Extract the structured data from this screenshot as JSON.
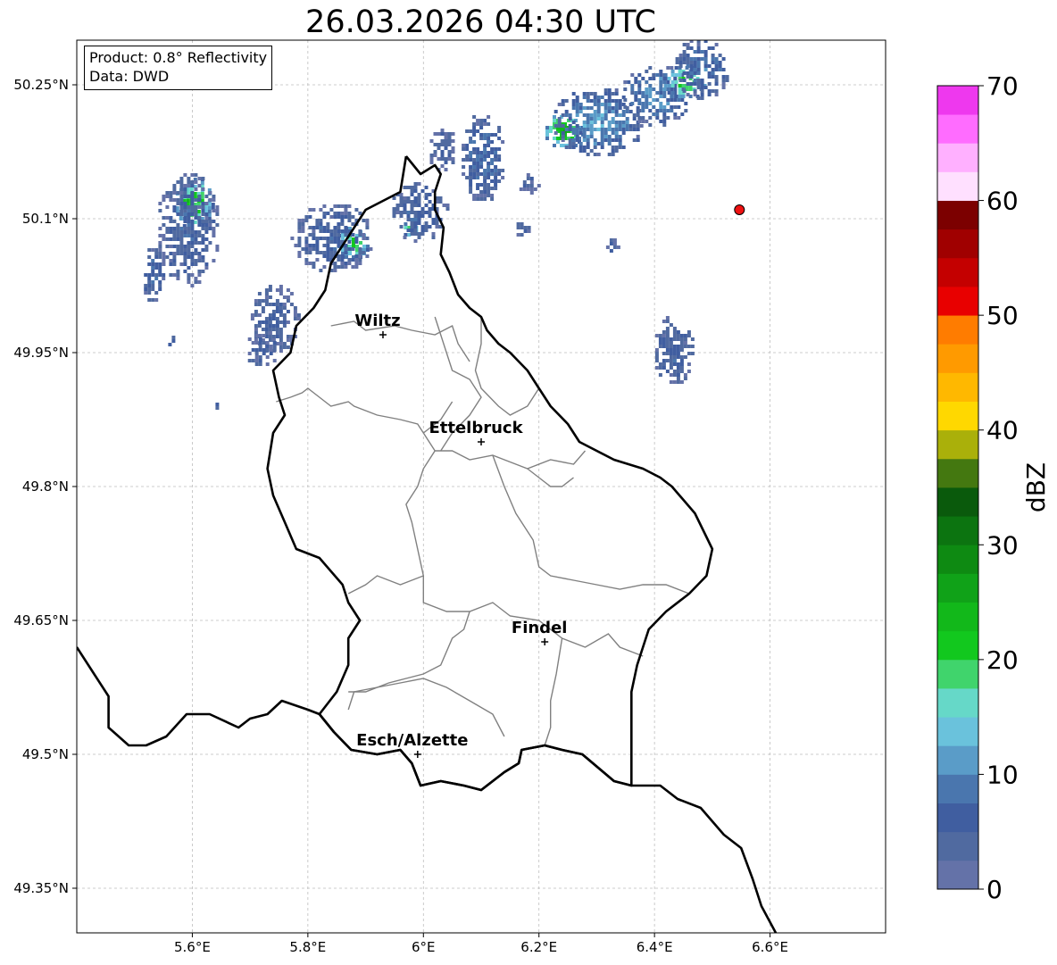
{
  "title": "26.03.2026 04:30 UTC",
  "info": {
    "product": "Product: 0.8° Reflectivity",
    "source": "Data: DWD"
  },
  "axes": {
    "x_ticks": [
      {
        "value": 5.6,
        "label": "5.6°E"
      },
      {
        "value": 5.8,
        "label": "5.8°E"
      },
      {
        "value": 6.0,
        "label": "6°E"
      },
      {
        "value": 6.2,
        "label": "6.2°E"
      },
      {
        "value": 6.4,
        "label": "6.4°E"
      },
      {
        "value": 6.6,
        "label": "6.6°E"
      }
    ],
    "y_ticks": [
      {
        "value": 50.25,
        "label": "50.25°N"
      },
      {
        "value": 50.1,
        "label": "50.1°N"
      },
      {
        "value": 49.95,
        "label": "49.95°N"
      },
      {
        "value": 49.8,
        "label": "49.8°N"
      },
      {
        "value": 49.65,
        "label": "49.65°N"
      },
      {
        "value": 49.5,
        "label": "49.5°N"
      },
      {
        "value": 49.35,
        "label": "49.35°N"
      }
    ],
    "lon_range": [
      5.4,
      6.8
    ],
    "lat_range": [
      49.3,
      50.3
    ],
    "grid": true
  },
  "cities": [
    {
      "name": "Wiltz",
      "lon": 5.93,
      "lat": 49.97
    },
    {
      "name": "Ettelbruck",
      "lon": 6.1,
      "lat": 49.85
    },
    {
      "name": "Findel",
      "lon": 6.21,
      "lat": 49.626
    },
    {
      "name": "Esch/Alzette",
      "lon": 5.99,
      "lat": 49.5
    }
  ],
  "radar_site": {
    "lon": 6.547,
    "lat": 50.11,
    "color": "#ee1111"
  },
  "colorbar": {
    "label": "dBZ",
    "min": 0,
    "max": 70,
    "step": 2.5,
    "tick_labels": [
      "0",
      "10",
      "20",
      "30",
      "40",
      "50",
      "60",
      "70"
    ],
    "colors": [
      "#6472a8",
      "#506aa0",
      "#405ea0",
      "#4a76ae",
      "#5a9cc8",
      "#6ac2dc",
      "#66d8c8",
      "#40d46c",
      "#12c81e",
      "#12b81a",
      "#10a218",
      "#0e8a12",
      "#0c7410",
      "#0a5a0c",
      "#447810",
      "#aab00a",
      "#ffd800",
      "#ffb800",
      "#ff9a00",
      "#ff7c00",
      "#e80000",
      "#c40000",
      "#a00000",
      "#7c0000",
      "#ffe0ff",
      "#ffb0ff",
      "#ff6cff",
      "#ee38ee"
    ]
  },
  "echoes": [
    {
      "lon": 5.6,
      "lat": 50.12,
      "rx": 0.035,
      "ry": 0.03,
      "dbz": 22
    },
    {
      "lon": 5.59,
      "lat": 50.09,
      "rx": 0.055,
      "ry": 0.065,
      "dbz": 6
    },
    {
      "lon": 5.53,
      "lat": 50.04,
      "rx": 0.02,
      "ry": 0.035,
      "dbz": 7
    },
    {
      "lon": 5.875,
      "lat": 50.075,
      "rx": 0.03,
      "ry": 0.02,
      "dbz": 20
    },
    {
      "lon": 5.84,
      "lat": 50.08,
      "rx": 0.07,
      "ry": 0.04,
      "dbz": 6
    },
    {
      "lon": 5.74,
      "lat": 49.99,
      "rx": 0.045,
      "ry": 0.04,
      "dbz": 5
    },
    {
      "lon": 5.72,
      "lat": 49.955,
      "rx": 0.03,
      "ry": 0.02,
      "dbz": 5
    },
    {
      "lon": 5.975,
      "lat": 50.09,
      "rx": 0.015,
      "ry": 0.01,
      "dbz": 18
    },
    {
      "lon": 5.99,
      "lat": 50.11,
      "rx": 0.05,
      "ry": 0.035,
      "dbz": 6
    },
    {
      "lon": 6.1,
      "lat": 50.17,
      "rx": 0.04,
      "ry": 0.05,
      "dbz": 8
    },
    {
      "lon": 6.03,
      "lat": 50.18,
      "rx": 0.025,
      "ry": 0.025,
      "dbz": 5
    },
    {
      "lon": 6.24,
      "lat": 50.2,
      "rx": 0.035,
      "ry": 0.02,
      "dbz": 24
    },
    {
      "lon": 6.3,
      "lat": 50.21,
      "rx": 0.08,
      "ry": 0.04,
      "dbz": 11
    },
    {
      "lon": 6.4,
      "lat": 50.24,
      "rx": 0.06,
      "ry": 0.035,
      "dbz": 10
    },
    {
      "lon": 6.45,
      "lat": 50.255,
      "rx": 0.04,
      "ry": 0.02,
      "dbz": 20
    },
    {
      "lon": 6.48,
      "lat": 50.27,
      "rx": 0.05,
      "ry": 0.035,
      "dbz": 8
    },
    {
      "lon": 6.43,
      "lat": 49.955,
      "rx": 0.035,
      "ry": 0.04,
      "dbz": 6
    },
    {
      "lon": 6.325,
      "lat": 50.07,
      "rx": 0.015,
      "ry": 0.012,
      "dbz": 4
    },
    {
      "lon": 6.17,
      "lat": 50.09,
      "rx": 0.015,
      "ry": 0.01,
      "dbz": 4
    },
    {
      "lon": 6.18,
      "lat": 50.14,
      "rx": 0.02,
      "ry": 0.015,
      "dbz": 4
    },
    {
      "lon": 5.56,
      "lat": 49.965,
      "rx": 0.008,
      "ry": 0.008,
      "dbz": 5
    },
    {
      "lon": 5.64,
      "lat": 49.89,
      "rx": 0.006,
      "ry": 0.008,
      "dbz": 5
    }
  ],
  "boundaries": {
    "country": [
      [
        [
          5.4,
          49.62
        ],
        [
          5.43,
          49.59
        ],
        [
          5.455,
          49.565
        ],
        [
          5.455,
          49.53
        ],
        [
          5.49,
          49.51
        ],
        [
          5.52,
          49.51
        ],
        [
          5.555,
          49.52
        ],
        [
          5.59,
          49.545
        ],
        [
          5.63,
          49.545
        ],
        [
          5.68,
          49.53
        ],
        [
          5.7,
          49.54
        ],
        [
          5.73,
          49.545
        ],
        [
          5.755,
          49.56
        ],
        [
          5.8,
          49.55
        ],
        [
          5.82,
          49.545
        ],
        [
          5.845,
          49.525
        ],
        [
          5.875,
          49.505
        ],
        [
          5.92,
          49.5
        ],
        [
          5.96,
          49.505
        ],
        [
          5.98,
          49.49
        ],
        [
          5.995,
          49.465
        ],
        [
          6.03,
          49.47
        ],
        [
          6.07,
          49.465
        ],
        [
          6.1,
          49.46
        ],
        [
          6.14,
          49.48
        ],
        [
          6.165,
          49.49
        ],
        [
          6.17,
          49.505
        ],
        [
          6.21,
          49.51
        ],
        [
          6.24,
          49.505
        ],
        [
          6.275,
          49.5
        ],
        [
          6.33,
          49.47
        ],
        [
          6.36,
          49.465
        ],
        [
          6.41,
          49.465
        ],
        [
          6.44,
          49.45
        ],
        [
          6.48,
          49.44
        ],
        [
          6.52,
          49.41
        ],
        [
          6.55,
          49.395
        ],
        [
          6.57,
          49.36
        ],
        [
          6.585,
          49.33
        ],
        [
          6.61,
          49.3
        ]
      ]
    ],
    "lux": [
      [
        [
          5.97,
          50.17
        ],
        [
          5.995,
          50.15
        ],
        [
          6.02,
          50.16
        ],
        [
          6.03,
          50.15
        ],
        [
          6.02,
          50.13
        ],
        [
          6.02,
          50.11
        ],
        [
          6.035,
          50.09
        ],
        [
          6.03,
          50.06
        ],
        [
          6.045,
          50.04
        ],
        [
          6.06,
          50.015
        ],
        [
          6.08,
          50.0
        ],
        [
          6.1,
          49.99
        ],
        [
          6.11,
          49.975
        ],
        [
          6.13,
          49.96
        ],
        [
          6.15,
          49.95
        ],
        [
          6.18,
          49.93
        ],
        [
          6.2,
          49.91
        ],
        [
          6.22,
          49.89
        ],
        [
          6.25,
          49.87
        ],
        [
          6.27,
          49.85
        ],
        [
          6.3,
          49.84
        ],
        [
          6.33,
          49.83
        ],
        [
          6.38,
          49.82
        ],
        [
          6.41,
          49.81
        ],
        [
          6.43,
          49.8
        ],
        [
          6.47,
          49.77
        ],
        [
          6.5,
          49.73
        ],
        [
          6.49,
          49.7
        ],
        [
          6.46,
          49.68
        ],
        [
          6.42,
          49.66
        ],
        [
          6.39,
          49.64
        ],
        [
          6.37,
          49.6
        ],
        [
          6.36,
          49.57
        ],
        [
          6.36,
          49.53
        ],
        [
          6.36,
          49.465
        ],
        [
          6.33,
          49.47
        ],
        [
          6.275,
          49.5
        ],
        [
          6.24,
          49.505
        ],
        [
          6.21,
          49.51
        ],
        [
          6.17,
          49.505
        ],
        [
          6.165,
          49.49
        ],
        [
          6.14,
          49.48
        ],
        [
          6.1,
          49.46
        ],
        [
          6.07,
          49.465
        ],
        [
          6.03,
          49.47
        ],
        [
          5.995,
          49.465
        ],
        [
          5.98,
          49.49
        ],
        [
          5.96,
          49.505
        ],
        [
          5.92,
          49.5
        ],
        [
          5.875,
          49.505
        ],
        [
          5.845,
          49.525
        ],
        [
          5.82,
          49.545
        ],
        [
          5.85,
          49.57
        ],
        [
          5.87,
          49.6
        ],
        [
          5.87,
          49.63
        ],
        [
          5.89,
          49.65
        ],
        [
          5.87,
          49.67
        ],
        [
          5.86,
          49.69
        ],
        [
          5.82,
          49.72
        ],
        [
          5.78,
          49.73
        ],
        [
          5.76,
          49.76
        ],
        [
          5.74,
          49.79
        ],
        [
          5.73,
          49.82
        ],
        [
          5.74,
          49.86
        ],
        [
          5.76,
          49.88
        ],
        [
          5.75,
          49.9
        ],
        [
          5.74,
          49.93
        ],
        [
          5.77,
          49.95
        ],
        [
          5.78,
          49.98
        ],
        [
          5.81,
          50.0
        ],
        [
          5.83,
          50.02
        ],
        [
          5.84,
          50.05
        ],
        [
          5.87,
          50.08
        ],
        [
          5.9,
          50.11
        ],
        [
          5.96,
          50.13
        ],
        [
          5.97,
          50.17
        ]
      ]
    ],
    "cantons": [
      [
        [
          5.745,
          49.895
        ],
        [
          5.77,
          49.9
        ],
        [
          5.79,
          49.905
        ],
        [
          5.8,
          49.91
        ],
        [
          5.82,
          49.9
        ],
        [
          5.84,
          49.89
        ],
        [
          5.87,
          49.895
        ],
        [
          5.88,
          49.89
        ],
        [
          5.92,
          49.88
        ],
        [
          5.96,
          49.875
        ],
        [
          5.99,
          49.87
        ],
        [
          6.0,
          49.86
        ],
        [
          6.02,
          49.84
        ]
      ],
      [
        [
          6.02,
          49.84
        ],
        [
          6.05,
          49.84
        ],
        [
          6.08,
          49.83
        ],
        [
          6.12,
          49.835
        ],
        [
          6.14,
          49.83
        ],
        [
          6.18,
          49.82
        ],
        [
          6.22,
          49.83
        ],
        [
          6.26,
          49.825
        ],
        [
          6.28,
          49.84
        ]
      ],
      [
        [
          5.84,
          49.98
        ],
        [
          5.88,
          49.985
        ],
        [
          5.9,
          49.975
        ],
        [
          5.95,
          49.98
        ],
        [
          5.98,
          49.975
        ],
        [
          6.02,
          49.97
        ],
        [
          6.05,
          49.98
        ],
        [
          6.06,
          49.96
        ],
        [
          6.08,
          49.94
        ]
      ],
      [
        [
          6.1,
          49.99
        ],
        [
          6.1,
          49.96
        ],
        [
          6.09,
          49.93
        ],
        [
          6.1,
          49.91
        ],
        [
          6.13,
          49.89
        ],
        [
          6.15,
          49.88
        ],
        [
          6.18,
          49.89
        ],
        [
          6.2,
          49.91
        ]
      ],
      [
        [
          6.02,
          49.99
        ],
        [
          6.05,
          49.93
        ],
        [
          6.08,
          49.92
        ],
        [
          6.1,
          49.9
        ],
        [
          6.08,
          49.88
        ],
        [
          6.05,
          49.86
        ],
        [
          6.03,
          49.84
        ]
      ],
      [
        [
          6.12,
          49.835
        ],
        [
          6.14,
          49.8
        ],
        [
          6.16,
          49.77
        ],
        [
          6.19,
          49.74
        ],
        [
          6.2,
          49.71
        ],
        [
          6.22,
          49.7
        ],
        [
          6.26,
          49.695
        ],
        [
          6.3,
          49.69
        ],
        [
          6.34,
          49.685
        ],
        [
          6.38,
          49.69
        ],
        [
          6.42,
          49.69
        ],
        [
          6.46,
          49.68
        ]
      ],
      [
        [
          6.02,
          49.84
        ],
        [
          6.0,
          49.82
        ],
        [
          5.99,
          49.8
        ],
        [
          5.97,
          49.78
        ],
        [
          5.98,
          49.76
        ],
        [
          5.99,
          49.73
        ],
        [
          6.0,
          49.7
        ],
        [
          5.96,
          49.69
        ],
        [
          5.92,
          49.7
        ],
        [
          5.9,
          49.69
        ],
        [
          5.87,
          49.68
        ]
      ],
      [
        [
          6.0,
          49.7
        ],
        [
          6.0,
          49.67
        ],
        [
          6.04,
          49.66
        ],
        [
          6.08,
          49.66
        ],
        [
          6.12,
          49.67
        ],
        [
          6.15,
          49.655
        ],
        [
          6.2,
          49.65
        ],
        [
          6.24,
          49.63
        ],
        [
          6.28,
          49.62
        ],
        [
          6.32,
          49.635
        ],
        [
          6.34,
          49.62
        ],
        [
          6.38,
          49.61
        ]
      ],
      [
        [
          6.08,
          49.66
        ],
        [
          6.07,
          49.64
        ],
        [
          6.05,
          49.63
        ],
        [
          6.03,
          49.6
        ],
        [
          6.0,
          49.59
        ],
        [
          5.97,
          49.585
        ],
        [
          5.94,
          49.58
        ],
        [
          5.9,
          49.57
        ],
        [
          5.87,
          49.57
        ]
      ],
      [
        [
          5.87,
          49.55
        ],
        [
          5.88,
          49.57
        ],
        [
          5.92,
          49.575
        ],
        [
          5.96,
          49.58
        ],
        [
          6.0,
          49.585
        ],
        [
          6.04,
          49.575
        ],
        [
          6.08,
          49.56
        ],
        [
          6.12,
          49.545
        ],
        [
          6.14,
          49.52
        ]
      ],
      [
        [
          6.24,
          49.63
        ],
        [
          6.23,
          49.59
        ],
        [
          6.22,
          49.56
        ],
        [
          6.22,
          49.53
        ],
        [
          6.21,
          49.51
        ]
      ],
      [
        [
          6.18,
          49.82
        ],
        [
          6.2,
          49.81
        ],
        [
          6.22,
          49.8
        ],
        [
          6.24,
          49.8
        ],
        [
          6.26,
          49.81
        ]
      ],
      [
        [
          6.0,
          49.86
        ],
        [
          6.03,
          49.875
        ],
        [
          6.05,
          49.895
        ]
      ]
    ]
  }
}
